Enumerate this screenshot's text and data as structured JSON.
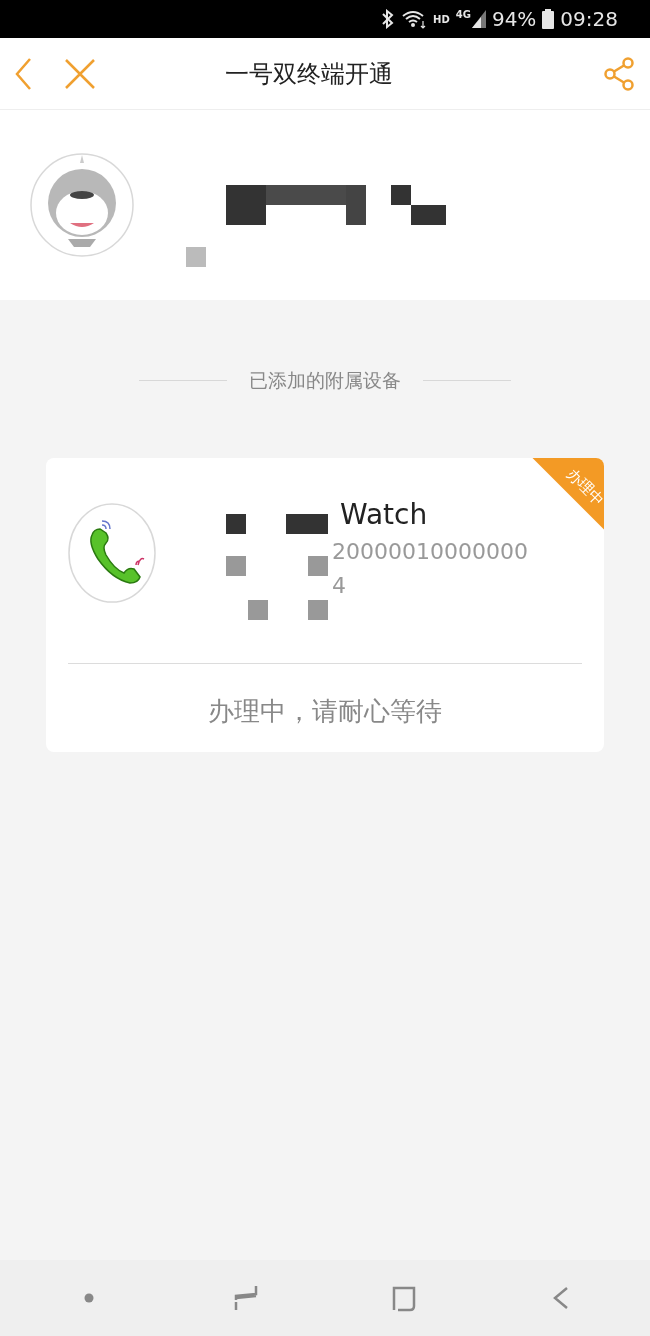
{
  "status_bar": {
    "network_labels": [
      "HD",
      "4G"
    ],
    "battery": "94%",
    "time": "09:28"
  },
  "header": {
    "title": "一号双终端开通"
  },
  "section_title": "已添加的附属设备",
  "devices": [
    {
      "name": "Watch",
      "number_lines": [
        "20000010000000",
        "4"
      ],
      "badge": "办理中",
      "status_text": "办理中，请耐心等待"
    }
  ]
}
